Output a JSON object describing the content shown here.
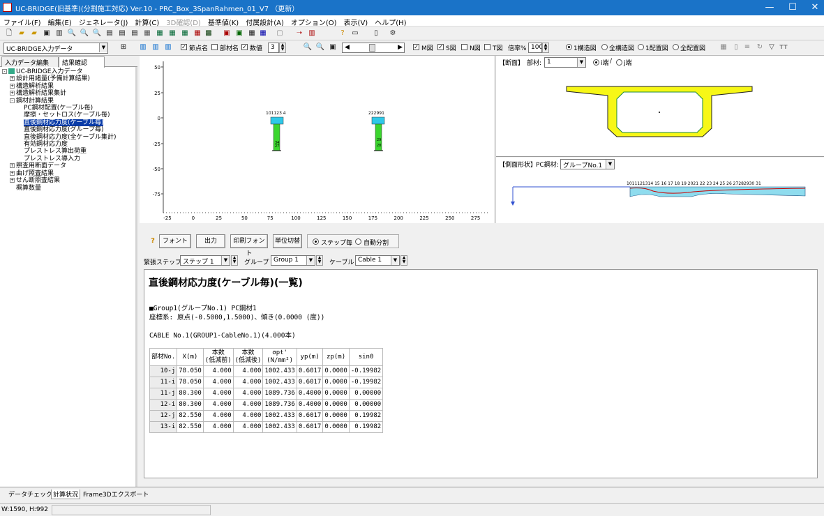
{
  "window": {
    "title": "UC-BRIDGE(旧基準)(分割施工対応) Ver.10 - PRC_Box_3SpanRahmen_01_V7 （更新）",
    "minimize": "—",
    "maximize": "☐",
    "close": "✕"
  },
  "menu": [
    "ファイル(F)",
    "編集(E)",
    "ジェネレータ(J)",
    "計算(C)",
    "3D確認(D)",
    "基準値(K)",
    "付属設計(A)",
    "オプション(O)",
    "表示(V)",
    "ヘルプ(H)"
  ],
  "toolbar2": {
    "data_select": "UC-BRIDGE入力データ",
    "node_label": "節点名",
    "member_label": "部材名",
    "value_label": "数値",
    "value_num": "3",
    "m_label": "M図",
    "s_label": "S図",
    "n_label": "N図",
    "t_label": "T図",
    "scale_label": "倍率%",
    "scale_value": "100",
    "view1": "1構造図",
    "view2": "全構造図",
    "view3": "1配置図",
    "view4": "全配置図"
  },
  "left_tabs": {
    "input": "入力データ編集",
    "result": "結果確認"
  },
  "tree": [
    {
      "label": "UC-BRIDGE入力データ",
      "level": 0,
      "pm": "-"
    },
    {
      "label": "設計用諸量(予備計算結果)",
      "level": 1,
      "pm": "+"
    },
    {
      "label": "構造解析結果",
      "level": 1,
      "pm": "+"
    },
    {
      "label": "構造解析結果集計",
      "level": 1,
      "pm": "+"
    },
    {
      "label": "鋼材計算結果",
      "level": 1,
      "pm": "-"
    },
    {
      "label": "PC鋼材配置(ケーブル毎)",
      "level": 2,
      "pm": ""
    },
    {
      "label": "摩擦・セットロス(ケーブル毎)",
      "level": 2,
      "pm": ""
    },
    {
      "label": "直後鋼材応力度(ケーブル毎)",
      "level": 2,
      "pm": "",
      "selected": true
    },
    {
      "label": "直後鋼材応力度(グループ毎)",
      "level": 2,
      "pm": ""
    },
    {
      "label": "直後鋼材応力度(全ケーブル集計)",
      "level": 2,
      "pm": ""
    },
    {
      "label": "有効鋼材応力度",
      "level": 2,
      "pm": ""
    },
    {
      "label": "プレストレス算出荷重",
      "level": 2,
      "pm": ""
    },
    {
      "label": "プレストレス導入力",
      "level": 2,
      "pm": ""
    },
    {
      "label": "照査用断面データ",
      "level": 1,
      "pm": "+"
    },
    {
      "label": "曲げ照査結果",
      "level": 1,
      "pm": "+"
    },
    {
      "label": "せん断照査結果",
      "level": 1,
      "pm": "+"
    },
    {
      "label": "概算数量",
      "level": 1,
      "pm": ""
    }
  ],
  "graph": {
    "y_ticks": [
      "50",
      "25",
      "0",
      "-25",
      "-50",
      "-75"
    ],
    "x_ticks": [
      "-25",
      "0",
      "25",
      "50",
      "75",
      "100",
      "125",
      "150",
      "175",
      "200",
      "225",
      "250",
      "275"
    ],
    "pier1_label": "101123 4",
    "pier2_label": "222991",
    "pier1_vals": [
      "34",
      "27"
    ],
    "pier2_vals": [
      "29",
      "28"
    ]
  },
  "section": {
    "label": "【断面】",
    "member_label": "部材:",
    "member_value": "1",
    "i_end": "i端",
    "j_end": "j端"
  },
  "side": {
    "label": "【側面形状】",
    "steel_label": "PC鋼材:",
    "steel_value": "グループNo.1",
    "numbers": "1011121314 15 16 17 18 19 2021 22 23 24 25 26 27282930 31"
  },
  "controls": {
    "font": "フォント",
    "output": "出力",
    "print_font": "印刷フォント",
    "unit_switch": "単位切替",
    "mode1": "ステップ毎",
    "mode2": "自動分割",
    "step_label": "緊張ステップ",
    "step_value": "ステップ 1",
    "group_label": "グループ",
    "group_value": "Group 1",
    "cable_label": "ケーブル",
    "cable_value": "Cable 1"
  },
  "report": {
    "title": "直後鋼材応力度(ケーブル毎)(一覧)",
    "line1": "■Group1(グループNo.1) PC鋼材1",
    "line2": "座標系: 原点(-0.5000,1.5000)、傾き(0.0000 (度))",
    "line3": "CABLE No.1(GROUP1-CableNo.1)(4.000本)",
    "headers": [
      "部材No.",
      "X(m)",
      "本数\n(低減前)",
      "本数\n(低減後)",
      "σpt'\n(N/mm²)",
      "yp(m)",
      "zp(m)",
      "sinθ"
    ],
    "rows": [
      [
        "10-j",
        "78.050",
        "4.000",
        "4.000",
        "1002.433",
        "0.6017",
        "0.0000",
        "-0.19982"
      ],
      [
        "11-i",
        "78.050",
        "4.000",
        "4.000",
        "1002.433",
        "0.6017",
        "0.0000",
        "-0.19982"
      ],
      [
        "11-j",
        "80.300",
        "4.000",
        "4.000",
        "1089.736",
        "0.4000",
        "0.0000",
        "0.00000"
      ],
      [
        "12-i",
        "80.300",
        "4.000",
        "4.000",
        "1089.736",
        "0.4000",
        "0.0000",
        "0.00000"
      ],
      [
        "12-j",
        "82.550",
        "4.000",
        "4.000",
        "1002.433",
        "0.6017",
        "0.0000",
        "0.19982"
      ],
      [
        "13-i",
        "82.550",
        "4.000",
        "4.000",
        "1002.433",
        "0.6017",
        "0.0000",
        "0.19982"
      ]
    ]
  },
  "bottom_tabs": {
    "check": "データチェック",
    "calc": "計算状況",
    "frame": "Frame3Dエクスポート"
  },
  "status": {
    "size": "W:1590, H:992"
  }
}
